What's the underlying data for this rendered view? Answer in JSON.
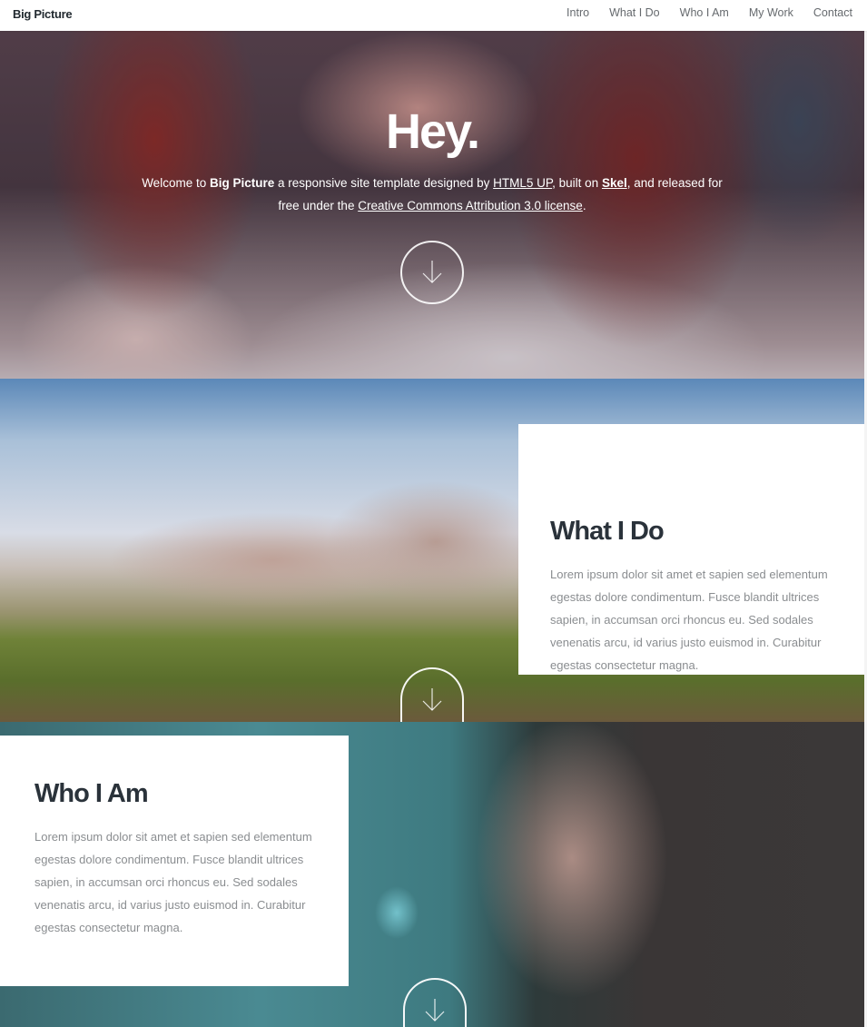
{
  "header": {
    "logo": "Big Picture",
    "nav": [
      {
        "label": "Intro"
      },
      {
        "label": "What I Do"
      },
      {
        "label": "Who I Am"
      },
      {
        "label": "My Work"
      },
      {
        "label": "Contact"
      }
    ]
  },
  "intro": {
    "title": "Hey.",
    "text_parts": {
      "p1": "Welcome to ",
      "brand": "Big Picture",
      "p2": " a responsive site template designed by ",
      "link1": "HTML5 UP",
      "p3": ", built on ",
      "link2": "Skel",
      "p4": ", and released for free under the ",
      "link3": "Creative Commons Attribution 3.0 license",
      "p5": "."
    },
    "next_icon": "arrow-down-icon"
  },
  "what_i_do": {
    "title": "What I Do",
    "text": "Lorem ipsum dolor sit amet et sapien sed elementum egestas dolore condimentum. Fusce blandit ultrices sapien, in accumsan orci rhoncus eu. Sed sodales venenatis arcu, id varius justo euismod in. Curabitur egestas consectetur magna.",
    "next_icon": "arrow-down-icon"
  },
  "who_i_am": {
    "title": "Who I Am",
    "text": "Lorem ipsum dolor sit amet et sapien sed elementum egestas dolore condimentum. Fusce blandit ultrices sapien, in accumsan orci rhoncus eu. Sed sodales venenatis arcu, id varius justo euismod in. Curabitur egestas consectetur magna.",
    "next_icon": "arrow-down-icon"
  },
  "colors": {
    "heading": "#2a323a",
    "body_text": "#8a8d90",
    "nav_text": "#666a6e"
  }
}
